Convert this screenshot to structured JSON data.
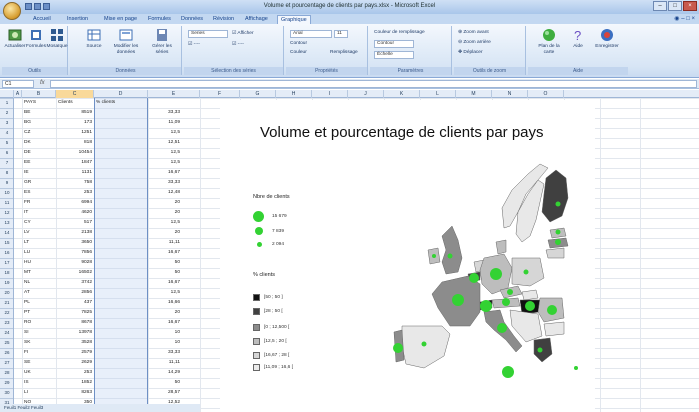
{
  "window": {
    "title": "Volume et pourcentage de clients par pays.xlsx - Microsoft Excel"
  },
  "tabs": [
    "Accueil",
    "Insertion",
    "Mise en page",
    "Formules",
    "Données",
    "Révision",
    "Affichage",
    "Graphique"
  ],
  "active_tab_index": 7,
  "ribbon": {
    "groups": [
      {
        "label": "Outils",
        "buttons": [
          "Actualiser",
          "Formules",
          "Mosaïque"
        ]
      },
      {
        "label": "Données",
        "buttons": [
          "Source",
          "Modifier les données",
          "Gérer les séries"
        ]
      },
      {
        "label": "Sélection des séries",
        "buttons": [
          "Series",
          "Afficher"
        ]
      },
      {
        "label": "Propriétés",
        "buttons": [
          "Arial",
          "Contour",
          "Couleur",
          "Remplissage"
        ]
      },
      {
        "label": "Paramètres",
        "buttons": [
          "Couleur de remplissage",
          "Contour",
          "Échelle"
        ]
      },
      {
        "label": "Outils de zoom",
        "buttons": [
          "Zoom avant",
          "Zoom arrière",
          "Déplacer"
        ]
      },
      {
        "label": "Aide",
        "buttons": [
          "Plan de la carte",
          "Aide",
          "Enregistrer"
        ]
      }
    ],
    "combo_font": "Arial",
    "combo_size": "11"
  },
  "formula_bar": {
    "name_box": "C1",
    "fx": "fx"
  },
  "columns": [
    "A",
    "B",
    "C",
    "D",
    "E",
    "F",
    "G",
    "H",
    "I",
    "J",
    "K",
    "L",
    "M",
    "N",
    "O"
  ],
  "selected_column": "C",
  "sheet": {
    "headers": [
      "PAYS",
      "Clients",
      "% clients"
    ],
    "rows": [
      [
        "BE",
        "8519",
        "33,33"
      ],
      [
        "BG",
        "173",
        "11,09"
      ],
      [
        "CZ",
        "1251",
        "12,5"
      ],
      [
        "DK",
        "818",
        "12,51"
      ],
      [
        "DE",
        "10454",
        "12,5"
      ],
      [
        "EE",
        "1847",
        "12,5"
      ],
      [
        "IE",
        "1131",
        "16,67"
      ],
      [
        "GR",
        "758",
        "33,33"
      ],
      [
        "ES",
        "253",
        "12,48"
      ],
      [
        "FR",
        "6994",
        "20"
      ],
      [
        "IT",
        "4620",
        "20"
      ],
      [
        "CY",
        "517",
        "12,5"
      ],
      [
        "LV",
        "2138",
        "20"
      ],
      [
        "LT",
        "3650",
        "11,11"
      ],
      [
        "LU",
        "7856",
        "16,67"
      ],
      [
        "HU",
        "9028",
        "50"
      ],
      [
        "MT",
        "16502",
        "50"
      ],
      [
        "NL",
        "3742",
        "16,67"
      ],
      [
        "AT",
        "2856",
        "12,5"
      ],
      [
        "PL",
        "437",
        "16,66"
      ],
      [
        "PT",
        "7825",
        "20"
      ],
      [
        "RO",
        "8678",
        "16,67"
      ],
      [
        "SI",
        "13978",
        "10"
      ],
      [
        "SK",
        "3528",
        "10"
      ],
      [
        "FI",
        "2579",
        "33,33"
      ],
      [
        "SE",
        "2629",
        "11,11"
      ],
      [
        "UK",
        "253",
        "14,29"
      ],
      [
        "IS",
        "1852",
        "50"
      ],
      [
        "LI",
        "8263",
        "28,57"
      ],
      [
        "NO",
        "350",
        "12,52"
      ],
      [
        "CH",
        "17679",
        "50"
      ]
    ]
  },
  "sheet_tabs": "Feuil1  Feuil2  Feuil3",
  "chart": {
    "title": "Volume et pourcentage de clients par pays",
    "legend_bubbles_title": "Nbre de clients",
    "legend_bubbles": [
      "15 679",
      "7 839",
      "2 094"
    ],
    "legend_shades_title": "% clients",
    "legend_shades": [
      "[50 ; 50 ]",
      "[28 ; 50 [",
      "[0 ; 12,500 [",
      "[12,5 ; 20 [",
      "[16,67 ; 28 [",
      "[11,09 ; 16,6 ["
    ],
    "colors": {
      "bubble": "#33d233",
      "land_light": "#e8e8e8",
      "land_mid": "#8c8c8c",
      "land_dark": "#404040",
      "land_black": "#111111"
    }
  }
}
